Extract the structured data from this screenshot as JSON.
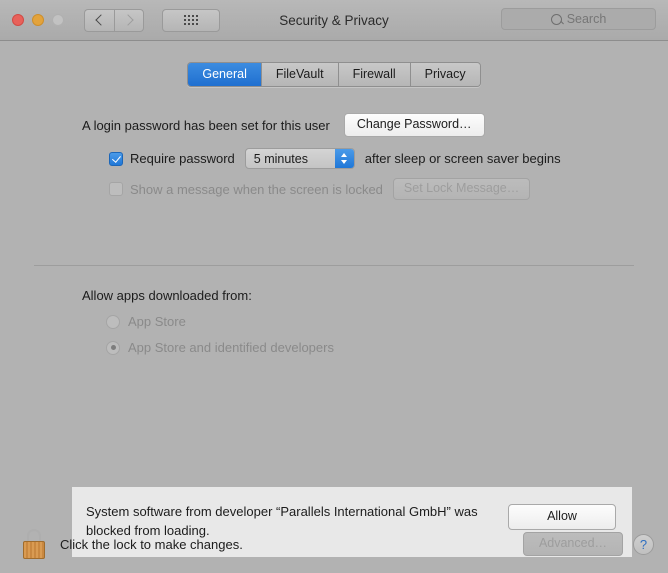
{
  "window": {
    "title": "Security & Privacy",
    "traffic_lights": [
      "close",
      "minimize",
      "zoom"
    ],
    "nav": {
      "back_icon": "chevron-left-icon",
      "forward_icon": "chevron-right-icon"
    },
    "show_all_icon": "grid-dots-icon",
    "search": {
      "placeholder": "Search",
      "value": "",
      "icon": "search-icon"
    }
  },
  "tabs": [
    {
      "label": "General",
      "active": true
    },
    {
      "label": "FileVault",
      "active": false
    },
    {
      "label": "Firewall",
      "active": false
    },
    {
      "label": "Privacy",
      "active": false
    }
  ],
  "general": {
    "password_status": "A login password has been set for this user",
    "change_password_label": "Change Password…",
    "require_password": {
      "checked": true,
      "label": "Require password",
      "delay_value": "5 minutes",
      "suffix": "after sleep or screen saver begins"
    },
    "lock_message": {
      "checked": false,
      "label": "Show a message when the screen is locked",
      "button_label": "Set Lock Message…",
      "disabled": true
    },
    "allow_apps": {
      "heading": "Allow apps downloaded from:",
      "disabled": true,
      "options": [
        {
          "label": "App Store",
          "selected": false
        },
        {
          "label": "App Store and identified developers",
          "selected": true
        }
      ]
    },
    "notice": {
      "text": "System software from developer “Parallels International GmbH” was blocked from loading.",
      "button_label": "Allow"
    }
  },
  "bottom_bar": {
    "lock_icon": "lock-closed-icon",
    "lock_text": "Click the lock to make changes.",
    "advanced_label": "Advanced…",
    "advanced_disabled": true,
    "help_label": "?"
  },
  "colors": {
    "accent_blue": "#1f77d8",
    "window_bg": "#b2b2b2",
    "notice_bg": "#e8e8e8",
    "lock_gold": "#d99b52"
  }
}
